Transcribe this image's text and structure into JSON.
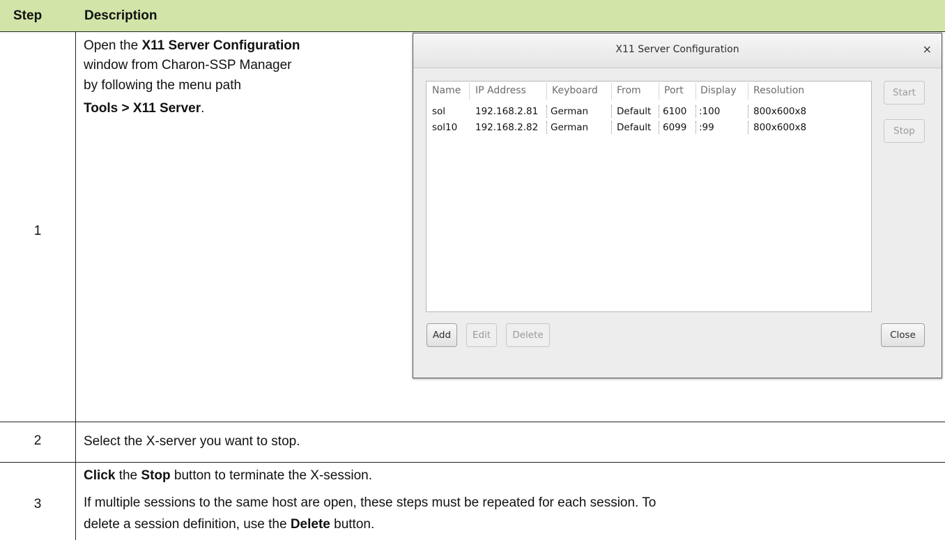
{
  "table": {
    "header": {
      "step": "Step",
      "description": "Description"
    },
    "rows": [
      {
        "step": "1",
        "line1_pre": "Open the ",
        "line1_bold": "X11 Server Configuration",
        "line2": "window from Charon-SSP Manager",
        "line3": "by following the menu path",
        "line4_bold": "Tools > X11 Server",
        "line4_post": "."
      },
      {
        "step": "2",
        "text": "Select the X-server you want to stop."
      },
      {
        "step": "3",
        "p1_bold1": "Click",
        "p1_mid1": " the ",
        "p1_bold2": "Stop",
        "p1_post": " button to terminate the X-session.",
        "p2_line1": "If multiple sessions to the same host are open, these steps must be repeated for each session. To",
        "p2_line2_pre": "delete a session definition, use the ",
        "p2_line2_bold": "Delete",
        "p2_line2_post": " button."
      }
    ]
  },
  "dialog": {
    "title": "X11 Server Configuration",
    "close_glyph": "×",
    "columns": [
      "Name",
      "IP Address",
      "Keyboard",
      "From",
      "Port",
      "Display",
      "Resolution"
    ],
    "servers": [
      {
        "name": "sol",
        "ip": "192.168.2.81",
        "keyboard": "German",
        "from": "Default",
        "port": "6100",
        "display": ":100",
        "resolution": "800x600x8"
      },
      {
        "name": "sol10",
        "ip": "192.168.2.82",
        "keyboard": "German",
        "from": "Default",
        "port": "6099",
        "display": ":99",
        "resolution": "800x600x8"
      }
    ],
    "buttons": {
      "start": "Start",
      "stop": "Stop",
      "add": "Add",
      "edit": "Edit",
      "delete": "Delete",
      "close": "Close"
    }
  },
  "colors": {
    "header_bg": "#d2e4a8",
    "grid_line": "#222222",
    "dialog_bg": "#ededed"
  }
}
